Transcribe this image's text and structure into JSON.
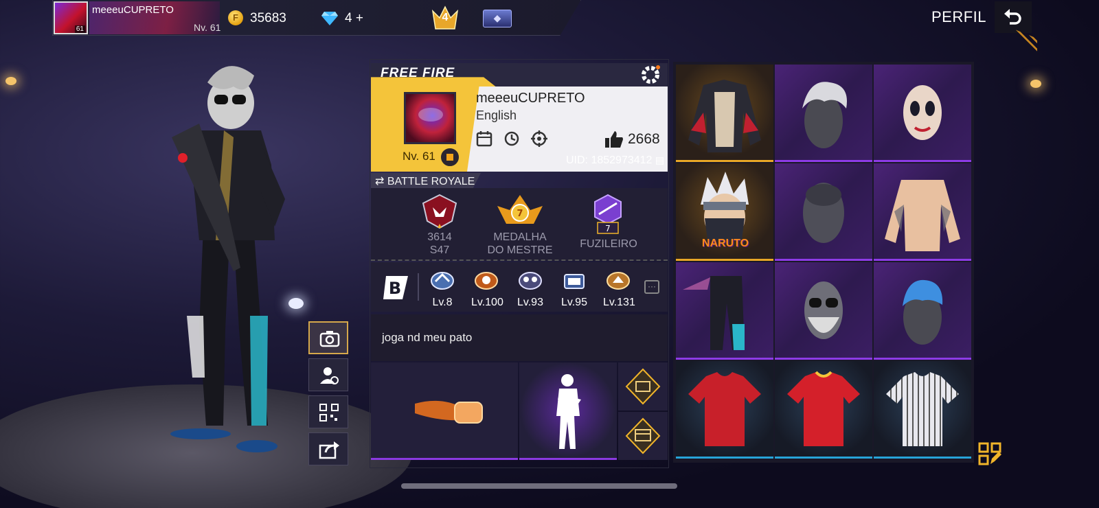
{
  "topbar": {
    "player_name": "meeeuCUPRETO",
    "avatar_level": "61",
    "level": "Nv. 61",
    "coins": "35683",
    "coin_symbol": "F",
    "diamonds": "4",
    "diamonds_plus": "+",
    "rank_number": "4"
  },
  "header": {
    "title": "PERFIL"
  },
  "profile": {
    "brand": "FREE FIRE",
    "name": "meeeuCUPRETO",
    "language": "English",
    "likes": "2668",
    "level": "Nv. 61",
    "uid": "UID: 1852973412"
  },
  "mode": {
    "label": "⇄ BATTLE ROYALE"
  },
  "ranks": [
    {
      "line1": "3614",
      "line2": "S47"
    },
    {
      "line1": "MEDALHA",
      "line2": "DO MESTRE",
      "badge_num": "7"
    },
    {
      "line1": "FUZILEIRO",
      "badge_num": "7"
    }
  ],
  "badges": [
    {
      "label": "Lv.8"
    },
    {
      "label": "Lv.100"
    },
    {
      "label": "Lv.93"
    },
    {
      "label": "Lv.95"
    },
    {
      "label": "Lv.131"
    }
  ],
  "bio": {
    "text": "joga nd meu pato"
  },
  "outfit_logo_text": "NARUTO",
  "colors": {
    "accent_gold": "#f4c43a",
    "rarity_purple": "#8d3be6",
    "rarity_gold": "#e8a726",
    "rarity_blue": "#27a4d8"
  },
  "icons": {
    "back": "back-arrow-icon",
    "settings": "gear-icon",
    "camera": "camera-icon",
    "avatar": "avatar-icon",
    "qr": "qr-code-icon",
    "share": "share-icon",
    "edit": "edit-outfit-icon"
  }
}
